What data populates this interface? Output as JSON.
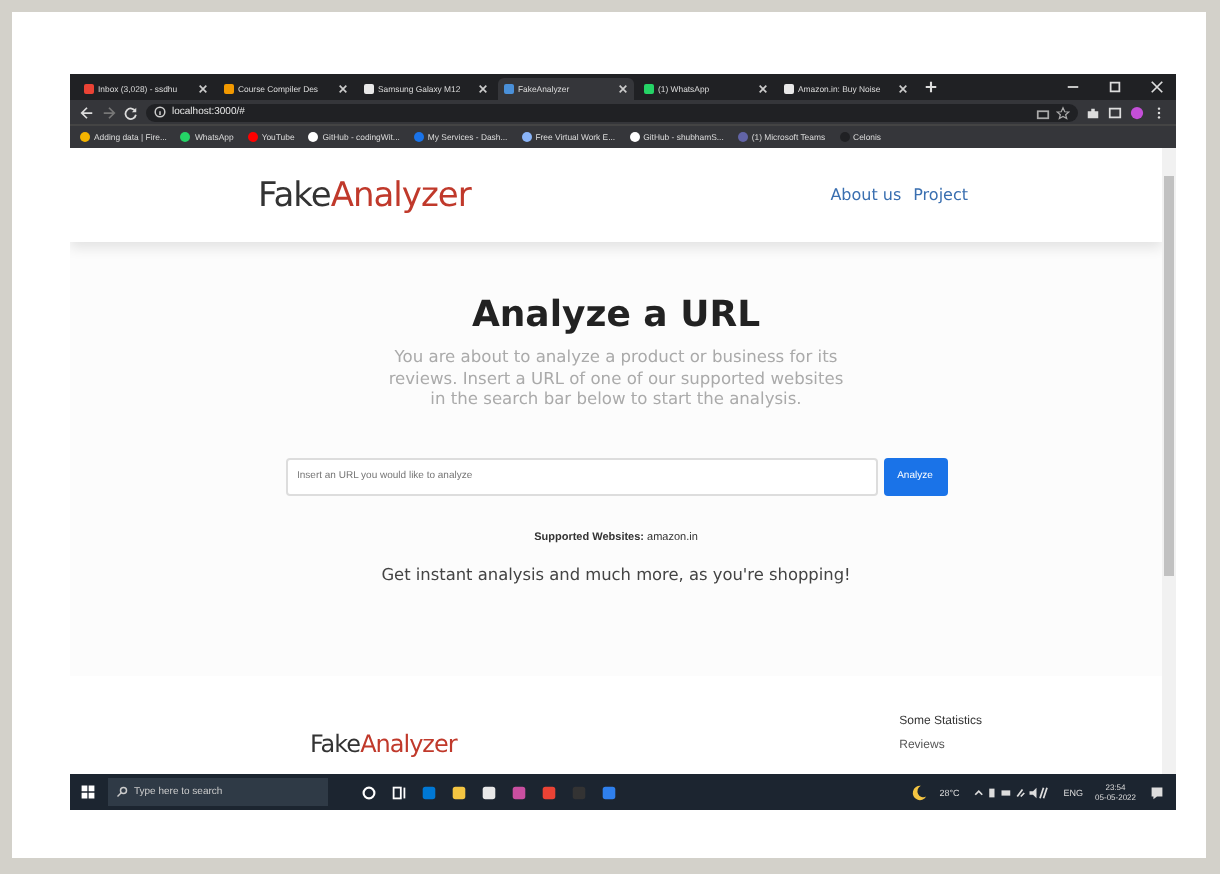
{
  "browser": {
    "tabs": [
      {
        "label": "Inbox (3,028) - ssdhu",
        "selected": false,
        "color": "#ea4335"
      },
      {
        "label": "Course Compiler Des",
        "selected": false,
        "color": "#f29900"
      },
      {
        "label": "Samsung Galaxy M12",
        "selected": false,
        "color": "#e8e8e8"
      },
      {
        "label": "FakeAnalyzer",
        "selected": true,
        "color": "#4a90d9"
      },
      {
        "label": "(1) WhatsApp",
        "selected": false,
        "color": "#25d366"
      },
      {
        "label": "Amazon.in: Buy Noise",
        "selected": false,
        "color": "#e8e8e8"
      }
    ],
    "address": "localhost:3000/#",
    "bookmarks": [
      {
        "label": "Adding data | Fire...",
        "color": "#f4b400"
      },
      {
        "label": "WhatsApp",
        "color": "#25d366"
      },
      {
        "label": "YouTube",
        "color": "#ff0000"
      },
      {
        "label": "GitHub - codingWit...",
        "color": "#ffffff"
      },
      {
        "label": "My Services - Dash...",
        "color": "#1a73e8"
      },
      {
        "label": "Free Virtual Work E...",
        "color": "#8ab4f8"
      },
      {
        "label": "GitHub - shubhamS...",
        "color": "#ffffff"
      },
      {
        "label": "(1) Microsoft Teams",
        "color": "#6264a7"
      },
      {
        "label": "Celonis",
        "color": "#202124"
      }
    ]
  },
  "page": {
    "brand": {
      "first": "Fake",
      "second": "Analyzer"
    },
    "nav": [
      "About us",
      "Project"
    ],
    "title": "Analyze a URL",
    "intro": "You are about to analyze a product or business for its reviews. Insert a URL of one of our supported websites in the search bar below to start the analysis.",
    "search": {
      "placeholder": "Insert an URL you would like to analyze"
    },
    "button": "Analyze",
    "supported": "**Supported Websites:** amazon.in",
    "tagline": "Get instant analysis and much more, as you're shopping!",
    "footer": {
      "brand": {
        "first": "Fake",
        "second": "Analyzer"
      },
      "heading": "Some Statistics",
      "link": "Reviews"
    }
  },
  "taskbar": {
    "search": {
      "placeholder": "Type here to search"
    },
    "weather": "28°C",
    "language": "ENG",
    "time": "23:54",
    "date": "05-05-2022"
  }
}
